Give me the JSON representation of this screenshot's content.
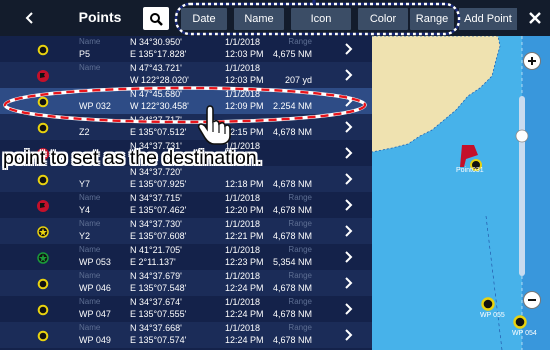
{
  "header": {
    "title": "Points",
    "sort_buttons": [
      "Date",
      "Name",
      "Icon",
      "Color",
      "Range"
    ],
    "add_label": "Add Point"
  },
  "list": {
    "rows": [
      {
        "name_label": "Name",
        "name": "P5",
        "lat": "N 34°30.950'",
        "lon": "E 135°17.828'",
        "date": "1/1/2018",
        "time": "12:03 PM",
        "range_label": "Range",
        "range": "4,675 NM",
        "icon": "yellow-ring"
      },
      {
        "name_label": "Name",
        "name": "",
        "lat": "N 47°43.721'",
        "lon": "W 122°28.020'",
        "date": "1/1/2018",
        "time": "12:03 PM",
        "range_label": "",
        "range": "207 yd",
        "icon": "red-flag"
      },
      {
        "name_label": "",
        "name": "WP 032",
        "lat": "N 47°45.680'",
        "lon": "W 122°30.458'",
        "date": "1/1/2018",
        "time": "12:09 PM",
        "range_label": "",
        "range": "2.254 NM",
        "icon": "yellow-ring"
      },
      {
        "name_label": "",
        "name": "Z2",
        "lat": "N 34°37.717'",
        "lon": "E 135°07.512'",
        "date": "",
        "time": "12:15 PM",
        "range_label": "",
        "range": "4,678 NM",
        "icon": "yellow-ring"
      },
      {
        "name_label": "",
        "name": "",
        "lat": "N 34°37.731'",
        "lon": "",
        "date": "1/1/2018",
        "time": "",
        "range_label": "",
        "range": "",
        "icon": "red-flag"
      },
      {
        "name_label": "",
        "name": "Y7",
        "lat": "N 34°37.720'",
        "lon": "E 135°07.925'",
        "date": "",
        "time": "12:18 PM",
        "range_label": "",
        "range": "4,678 NM",
        "icon": "yellow-ring"
      },
      {
        "name_label": "Name",
        "name": "Y4",
        "lat": "N 34°37.715'",
        "lon": "E 135°07.462'",
        "date": "1/1/2018",
        "time": "12:20 PM",
        "range_label": "Range",
        "range": "4,678 NM",
        "icon": "red-flag"
      },
      {
        "name_label": "Name",
        "name": "Y2",
        "lat": "N 34°37.730'",
        "lon": "E 135°07.608'",
        "date": "1/1/2018",
        "time": "12:21 PM",
        "range_label": "Range",
        "range": "4,678 NM",
        "icon": "yellow-star"
      },
      {
        "name_label": "Name",
        "name": "WP 053",
        "lat": "N 41°21.705'",
        "lon": "E 2°11.137'",
        "date": "1/1/2018",
        "time": "12:23 PM",
        "range_label": "Range",
        "range": "5,354 NM",
        "icon": "green-star"
      },
      {
        "name_label": "Name",
        "name": "WP 046",
        "lat": "N 34°37.679'",
        "lon": "E 135°07.548'",
        "date": "1/1/2018",
        "time": "12:24 PM",
        "range_label": "Range",
        "range": "4,678 NM",
        "icon": "yellow-ring"
      },
      {
        "name_label": "Name",
        "name": "WP 047",
        "lat": "N 34°37.674'",
        "lon": "E 135°07.555'",
        "date": "1/1/2018",
        "time": "12:24 PM",
        "range_label": "Range",
        "range": "4,678 NM",
        "icon": "yellow-ring"
      },
      {
        "name_label": "Name",
        "name": "WP 049",
        "lat": "N 34°37.668'",
        "lon": "E 135°07.574'",
        "date": "1/1/2018",
        "time": "12:24 PM",
        "range_label": "Range",
        "range": "4,678 NM",
        "icon": "yellow-ring"
      }
    ]
  },
  "map": {
    "waypoints": [
      "Point031",
      "WP 055",
      "WP 054"
    ]
  },
  "callout": {
    "text": "point to set as the destination."
  },
  "colors": {
    "accent": "#3b4d66",
    "highlight": "#2e4c86",
    "water": "#47b2ea",
    "land": "#efe2b0",
    "callout_dash": "#e8141b"
  }
}
